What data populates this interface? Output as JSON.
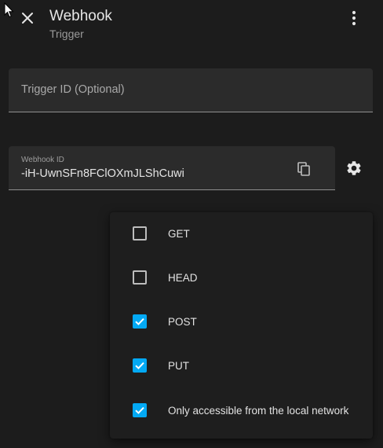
{
  "header": {
    "title": "Webhook",
    "subtitle": "Trigger"
  },
  "icons": {
    "close": "close-icon",
    "menu": "more-vertical-icon",
    "copy": "copy-icon",
    "settings": "gear-icon",
    "check": "check-icon"
  },
  "trigger_field": {
    "placeholder": "Trigger ID (Optional)"
  },
  "webhook_field": {
    "label": "Webhook ID",
    "value": "-iH-UwnSFn8FClOXmJLShCuwi"
  },
  "methods_menu": {
    "items": [
      {
        "label": "GET",
        "checked": false
      },
      {
        "label": "HEAD",
        "checked": false
      },
      {
        "label": "POST",
        "checked": true
      },
      {
        "label": "PUT",
        "checked": true
      },
      {
        "label": "Only accessible from the local network",
        "checked": true
      }
    ]
  },
  "colors": {
    "background": "#1c1c1c",
    "field_bg": "#2b2b2b",
    "accent": "#03a9f4",
    "text": "#e1e1e1",
    "muted": "#9b9b9b"
  }
}
